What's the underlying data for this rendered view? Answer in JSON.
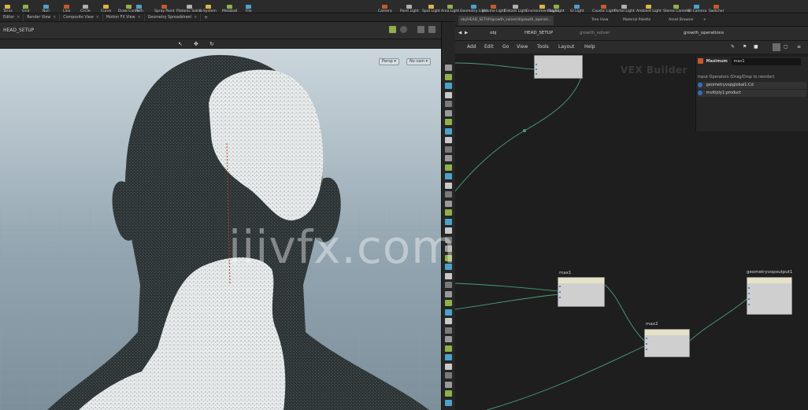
{
  "shelf": {
    "tools": [
      "Torus",
      "Grid",
      "Null",
      "Line",
      "Circle",
      "Curve",
      "Draw Curve",
      "Path",
      "Spray Paint",
      "Platonic Solids",
      "L-System",
      "Metaball",
      "File",
      "Camera",
      "Point Light",
      "Spot Light",
      "Area Light",
      "Geometry Light",
      "Volume Light",
      "Distant Light",
      "Environment Light",
      "Sky Light",
      "GI Light",
      "Caustic Light",
      "Portal Light",
      "Ambient Light",
      "Stereo Camera",
      "VR Camera",
      "Switcher"
    ]
  },
  "pane_tabs": [
    "Editor",
    "Render View",
    "Composite View",
    "Motion FX View",
    "Geometry Spreadsheet"
  ],
  "viewport": {
    "path_label": "HEAD_SETUP",
    "persp_label": "Persp",
    "cam_label": "No cam"
  },
  "network_tabs": {
    "main": "obj/HEAD_SETUP/growth_solver/d/growth_operati...",
    "tree": "Tree View",
    "material": "Material Palette",
    "asset": "Asset Browser"
  },
  "network_path": {
    "root": "obj",
    "node1": "HEAD_SETUP",
    "node2": "growth_solver",
    "node3": "growth_operations"
  },
  "menu": [
    "Add",
    "Edit",
    "Go",
    "View",
    "Tools",
    "Layout",
    "Help"
  ],
  "vex_label": "VEX Builder",
  "parm_panel": {
    "type": "Maximum",
    "name": "max1",
    "input_hint": "Input Operators (Drag/Drop to reorder)",
    "inputs": [
      "geometryvopglobal1:Cd",
      "multiply1:product"
    ]
  },
  "nodes": {
    "max1": "max1",
    "max2": "max2",
    "output": "geometryvopoutput1"
  },
  "watermark": "iiivfx.com"
}
